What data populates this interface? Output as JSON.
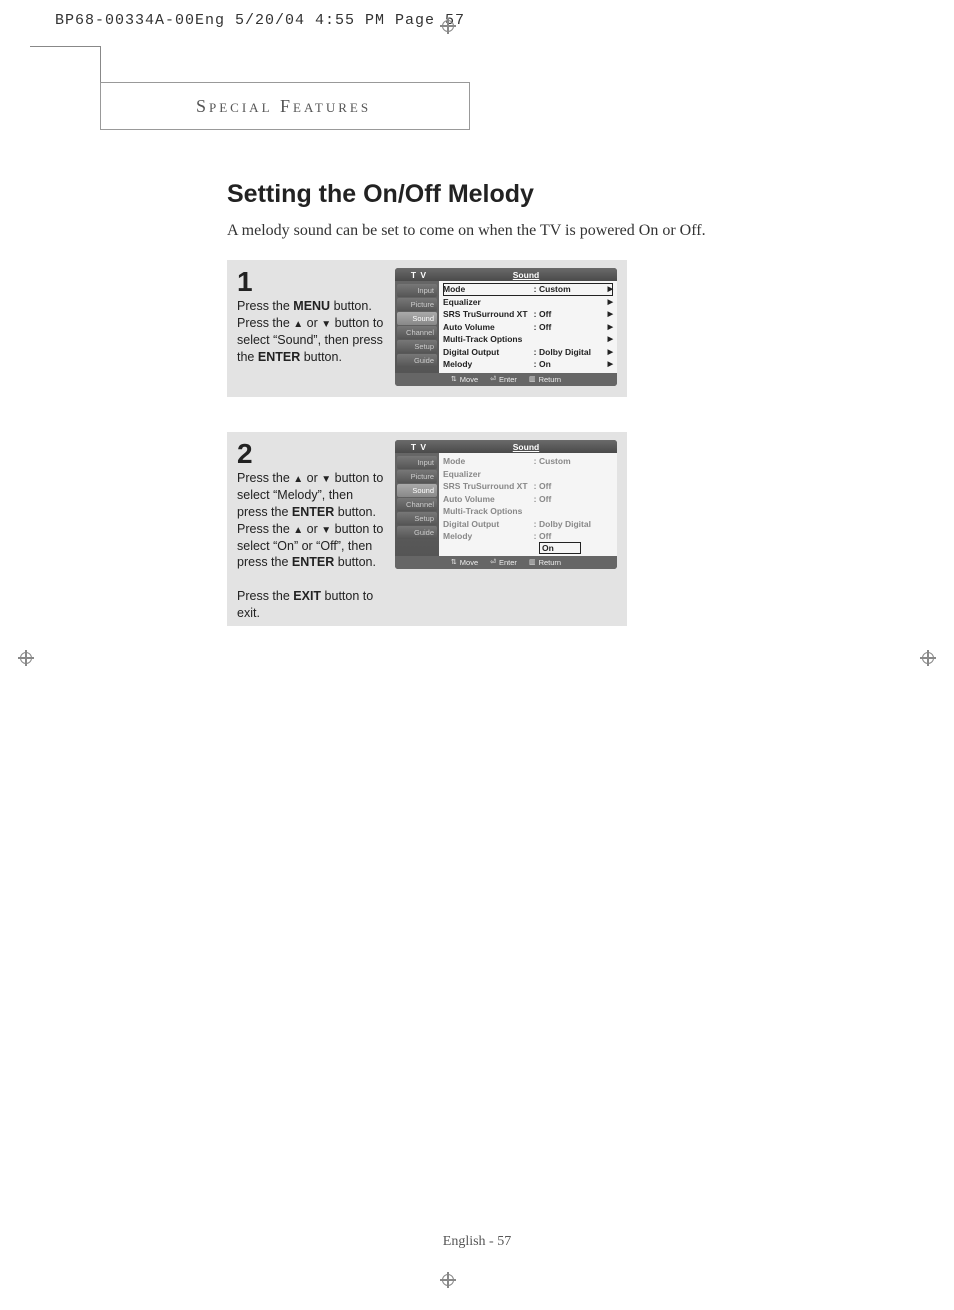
{
  "print_header": "BP68-00334A-00Eng  5/20/04  4:55 PM  Page 57",
  "section_label": "Special Features",
  "title": "Setting the On/Off Melody",
  "intro": "A melody sound can be set to come on when the TV is powered On or Off.",
  "steps": {
    "s1": {
      "num": "1",
      "l1a": "Press the ",
      "l1b": "MENU",
      "l1c": " button.",
      "l2a": "Press the ",
      "l2b": " or ",
      "l2c": " button to select “Sound”, then press the ",
      "l2d": "ENTER",
      "l2e": " button."
    },
    "s2": {
      "num": "2",
      "l1a": "Press the ",
      "l1b": " or ",
      "l1c": " button to select “Melody”, then press the ",
      "l1d": "ENTER",
      "l1e": " button.",
      "l2a": "Press the ",
      "l2b": " or ",
      "l2c": " button to select “On” or “Off”, then press the ",
      "l2d": "ENTER",
      "l2e": " button.",
      "l3a": "Press the ",
      "l3b": "EXIT",
      "l3c": " button to exit."
    }
  },
  "osd": {
    "tv": "T V",
    "title": "Sound",
    "side": [
      "Input",
      "Picture",
      "Sound",
      "Channel",
      "Setup",
      "Guide"
    ],
    "rows": [
      {
        "lbl": "Mode",
        "val": "Custom"
      },
      {
        "lbl": "Equalizer",
        "val": ""
      },
      {
        "lbl": "SRS TruSurround XT",
        "val": "Off"
      },
      {
        "lbl": "Auto Volume",
        "val": "Off"
      },
      {
        "lbl": "Multi-Track Options",
        "val": ""
      },
      {
        "lbl": "Digital Output",
        "val": "Dolby Digital"
      },
      {
        "lbl": "Melody",
        "val": "On"
      }
    ],
    "melody_options": [
      "Off",
      "On"
    ],
    "footer": {
      "move": "Move",
      "enter": "Enter",
      "return": "Return"
    }
  },
  "footer": "English - 57"
}
